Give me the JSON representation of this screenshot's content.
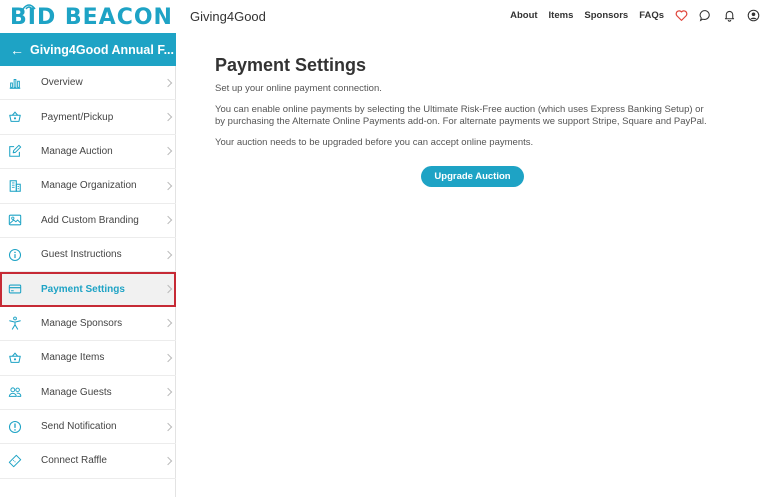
{
  "header": {
    "logo_text": "BID BEACON",
    "org_name": "Giving4Good",
    "nav": [
      "About",
      "Items",
      "Sponsors",
      "FAQs"
    ],
    "icons": [
      "heart-icon",
      "chat-icon",
      "bell-icon",
      "user-icon"
    ]
  },
  "sidebar": {
    "back_title": "Giving4Good Annual F...",
    "items": [
      {
        "label": "Overview",
        "icon": "bar-chart-icon"
      },
      {
        "label": "Payment/Pickup",
        "icon": "basket-icon"
      },
      {
        "label": "Manage Auction",
        "icon": "edit-icon"
      },
      {
        "label": "Manage Organization",
        "icon": "building-icon"
      },
      {
        "label": "Add Custom Branding",
        "icon": "image-icon"
      },
      {
        "label": "Guest Instructions",
        "icon": "info-icon"
      },
      {
        "label": "Payment Settings",
        "icon": "credit-card-icon",
        "active": true
      },
      {
        "label": "Manage Sponsors",
        "icon": "person-icon"
      },
      {
        "label": "Manage Items",
        "icon": "basket-icon"
      },
      {
        "label": "Manage Guests",
        "icon": "users-icon"
      },
      {
        "label": "Send Notification",
        "icon": "alert-icon"
      },
      {
        "label": "Connect Raffle",
        "icon": "ticket-icon"
      }
    ]
  },
  "main": {
    "title": "Payment Settings",
    "subtitle": "Set up your online payment connection.",
    "description": "You can enable online payments by selecting the Ultimate Risk-Free auction (which uses Express Banking Setup) or by purchasing the Alternate Online Payments add-on. For alternate payments we support Stripe, Square and PayPal.",
    "notice": "Your auction needs to be upgraded before you can accept online payments.",
    "upgrade_label": "Upgrade Auction"
  },
  "colors": {
    "accent": "#1ea3c5",
    "highlight_border": "#c62a35",
    "heart": "#e0463c"
  }
}
